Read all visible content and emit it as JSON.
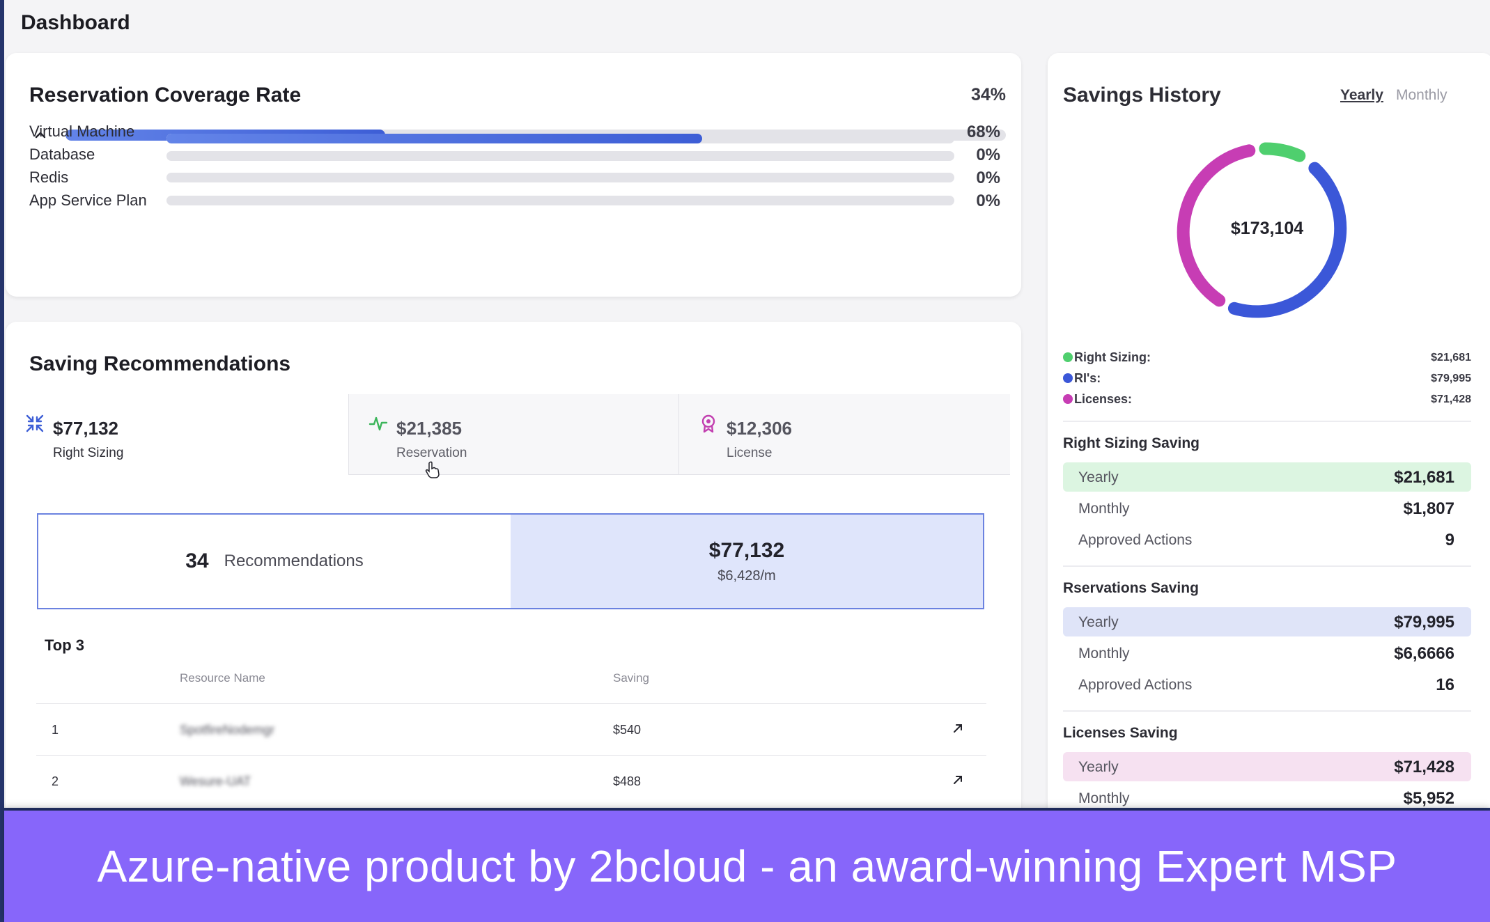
{
  "page": {
    "title": "Dashboard"
  },
  "coverage": {
    "title": "Reservation Coverage Rate",
    "overall_pct": "34%",
    "overall_fill": 0.34,
    "rows": [
      {
        "label": "Virtual Machine",
        "pct": "68%",
        "fill": 0.68
      },
      {
        "label": "Database",
        "pct": "0%",
        "fill": 0
      },
      {
        "label": "Redis",
        "pct": "0%",
        "fill": 0
      },
      {
        "label": "App Service Plan",
        "pct": "0%",
        "fill": 0
      }
    ]
  },
  "recommendations": {
    "title": "Saving Recommendations",
    "tiles": [
      {
        "amount": "$77,132",
        "label": "Right Sizing",
        "icon": "compress-arrows-icon",
        "color": "#3d5ed6"
      },
      {
        "amount": "$21,385",
        "label": "Reservation",
        "icon": "activity-pulse-icon",
        "color": "#3bb55a"
      },
      {
        "amount": "$12,306",
        "label": "License",
        "icon": "award-badge-icon",
        "color": "#c23fb0"
      }
    ],
    "summary": {
      "count": "34",
      "count_label": "Recommendations",
      "amount": "$77,132",
      "monthly": "$6,428/m"
    },
    "top_label": "Top 3",
    "columns": {
      "resource": "Resource Name",
      "saving": "Saving"
    },
    "rows": [
      {
        "rank": "1",
        "resource": "SpotfireNodemgr",
        "saving": "$540"
      },
      {
        "rank": "2",
        "resource": "Wesure-UAT",
        "saving": "$488"
      }
    ]
  },
  "history": {
    "title": "Savings History",
    "toggle_yearly": "Yearly",
    "toggle_monthly": "Monthly",
    "total": "$173,104",
    "legend": [
      {
        "label": "Right Sizing:",
        "value": "$21,681",
        "color": "#4fcf6e"
      },
      {
        "label": "RI's:",
        "value": "$79,995",
        "color": "#3b57d8"
      },
      {
        "label": "Licenses:",
        "value": "$71,428",
        "color": "#c73db4"
      }
    ],
    "sections": [
      {
        "title": "Right Sizing Saving",
        "highlight": "#dcf5e1",
        "rows": [
          {
            "k": "Yearly",
            "v": "$21,681"
          },
          {
            "k": "Monthly",
            "v": "$1,807"
          },
          {
            "k": "Approved Actions",
            "v": "9"
          }
        ]
      },
      {
        "title": "Rservations Saving",
        "highlight": "#dfe4f8",
        "rows": [
          {
            "k": "Yearly",
            "v": "$79,995"
          },
          {
            "k": "Monthly",
            "v": "$6,6666"
          },
          {
            "k": "Approved Actions",
            "v": "16"
          }
        ]
      },
      {
        "title": "Licenses Saving",
        "highlight": "#f6e1f1",
        "rows": [
          {
            "k": "Yearly",
            "v": "$71,428"
          },
          {
            "k": "Monthly",
            "v": "$5,952"
          }
        ]
      }
    ]
  },
  "banner": {
    "text": "Azure-native product by 2bcloud - an award-winning Expert MSP"
  }
}
